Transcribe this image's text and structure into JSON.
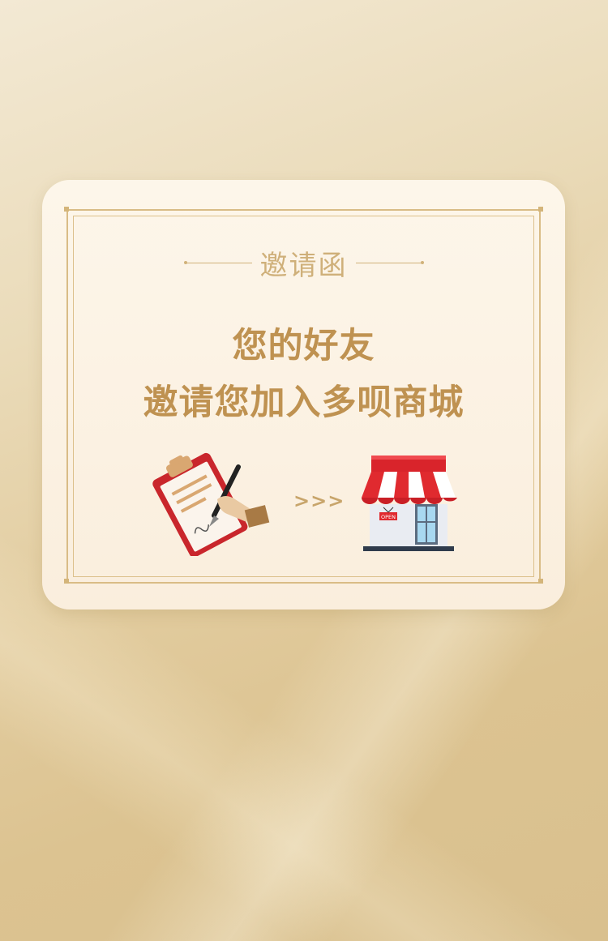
{
  "invitation": {
    "subtitle": "邀请函",
    "headline_line1": "您的好友",
    "headline_line2": "邀请您加入多呗商城",
    "arrows": ">>>"
  },
  "store": {
    "sign_text": "OPEN"
  },
  "icons": [
    "clipboard-sign-icon",
    "store-icon"
  ],
  "colors": {
    "gold_text": "#bf9251",
    "frame": "#d9bc86",
    "store_red": "#e02a2f"
  }
}
